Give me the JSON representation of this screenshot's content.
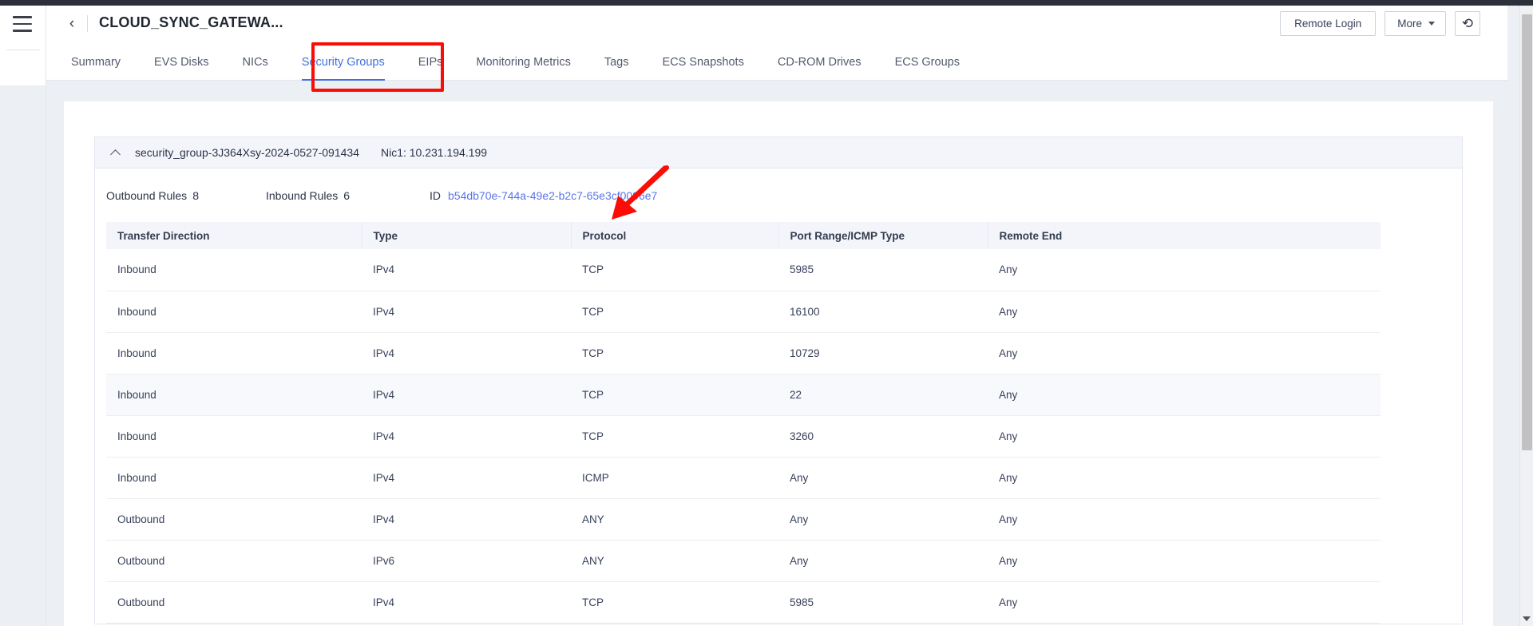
{
  "window": {
    "hamburger_icon": "hamburger-menu-icon",
    "back_icon": "chevron-left-icon",
    "title": "CLOUD_SYNC_GATEWA..."
  },
  "header": {
    "remote_login_label": "Remote Login",
    "more_label": "More",
    "refresh_icon": "refresh-icon",
    "refresh_glyph": "⟳"
  },
  "tabs": [
    {
      "label": "Summary",
      "active": false
    },
    {
      "label": "EVS Disks",
      "active": false
    },
    {
      "label": "NICs",
      "active": false
    },
    {
      "label": "Security Groups",
      "active": true
    },
    {
      "label": "EIPs",
      "active": false
    },
    {
      "label": "Monitoring Metrics",
      "active": false
    },
    {
      "label": "Tags",
      "active": false
    },
    {
      "label": "ECS Snapshots",
      "active": false
    },
    {
      "label": "CD-ROM Drives",
      "active": false
    },
    {
      "label": "ECS Groups",
      "active": false
    }
  ],
  "security_group": {
    "collapse_icon": "chevron-up-icon",
    "name": "security_group-3J364Xsy-2024-0527-091434",
    "nic": "Nic1: 10.231.194.199",
    "outbound_rules_label": "Outbound Rules",
    "outbound_rules_count": "8",
    "inbound_rules_label": "Inbound Rules",
    "inbound_rules_count": "6",
    "id_label": "ID",
    "id_value": "b54db70e-744a-49e2-b2c7-65e3cf0096e7"
  },
  "table": {
    "columns": [
      "Transfer Direction",
      "Type",
      "Protocol",
      "Port Range/ICMP Type",
      "Remote End"
    ],
    "rows": [
      {
        "direction": "Inbound",
        "type": "IPv4",
        "protocol": "TCP",
        "port": "5985",
        "remote": "Any"
      },
      {
        "direction": "Inbound",
        "type": "IPv4",
        "protocol": "TCP",
        "port": "16100",
        "remote": "Any"
      },
      {
        "direction": "Inbound",
        "type": "IPv4",
        "protocol": "TCP",
        "port": "10729",
        "remote": "Any"
      },
      {
        "direction": "Inbound",
        "type": "IPv4",
        "protocol": "TCP",
        "port": "22",
        "remote": "Any"
      },
      {
        "direction": "Inbound",
        "type": "IPv4",
        "protocol": "TCP",
        "port": "3260",
        "remote": "Any"
      },
      {
        "direction": "Inbound",
        "type": "IPv4",
        "protocol": "ICMP",
        "port": "Any",
        "remote": "Any"
      },
      {
        "direction": "Outbound",
        "type": "IPv4",
        "protocol": "ANY",
        "port": "Any",
        "remote": "Any"
      },
      {
        "direction": "Outbound",
        "type": "IPv6",
        "protocol": "ANY",
        "port": "Any",
        "remote": "Any"
      },
      {
        "direction": "Outbound",
        "type": "IPv4",
        "protocol": "TCP",
        "port": "5985",
        "remote": "Any"
      }
    ]
  },
  "annotations": {
    "highlight_color": "#fb0d06",
    "box_target": "Security Groups",
    "arrow_target": "security group ID"
  },
  "colors": {
    "accent": "#3f6fe0",
    "link": "#5b74e8",
    "header_bg": "#f3f5fa",
    "page_bg": "#eceff4"
  },
  "scrollbar": {
    "down_arrow_icon": "scroll-down-arrow-icon"
  }
}
